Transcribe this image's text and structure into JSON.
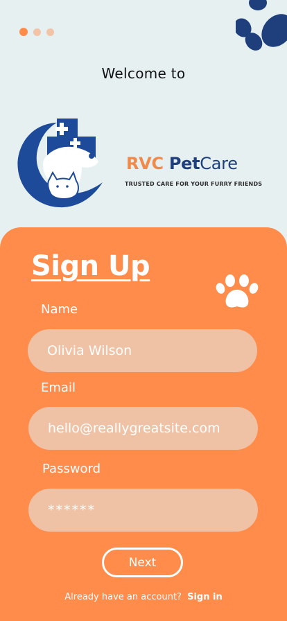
{
  "header": {
    "welcome_text": "Welcome to",
    "page_indicator": {
      "count": 3,
      "active_index": 0
    }
  },
  "logo": {
    "brand_part1": "RVC",
    "brand_part2": "Pet",
    "brand_part3": "Care",
    "tagline": "TRUSTED CARE FOR YOUR FURRY FRIENDS"
  },
  "form": {
    "title": "Sign Up",
    "name_label": "Name",
    "name_value": "Olivia Wilson",
    "email_label": "Email",
    "email_value": "hello@reallygreatsite.com",
    "password_label": "Password",
    "password_value": "******",
    "next_label": "Next",
    "account_prompt": "Already have an account?",
    "signin_label": "Sign in"
  },
  "colors": {
    "accent_orange": "#ff8c4b",
    "brand_blue": "#1e3f7c",
    "field_fill": "#efc2a6",
    "background": "#e6f0f1"
  },
  "icons": [
    "paw-print-icon",
    "pet-care-logo-icon",
    "paw-icon"
  ]
}
